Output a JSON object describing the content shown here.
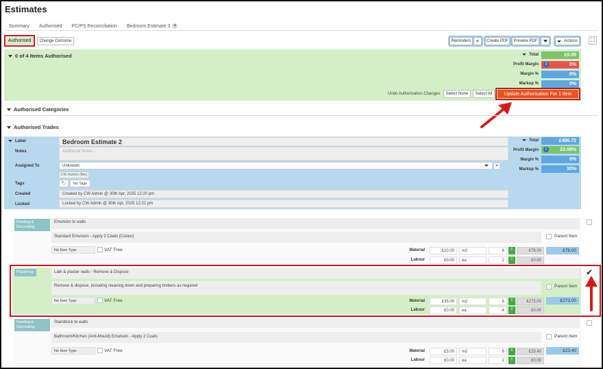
{
  "page": {
    "title": "Estimates"
  },
  "tabs": [
    {
      "label": "Summary"
    },
    {
      "label": "Authorised"
    },
    {
      "label": "PC/PS Reconciliation"
    },
    {
      "label": "Bedroom Estimate 3"
    }
  ],
  "toolbar": {
    "status": "Authorised",
    "change_outcome": "Change Outcome",
    "reminders": "Reminders",
    "plus": "+",
    "create_pdf": "Create PDF",
    "preview_pdf": "Preview PDF",
    "actions": "Actions"
  },
  "summary": {
    "heading": "0 of 4 Items Authorised",
    "total_label": "Total",
    "total_value": "£0.00",
    "profit_label": "Profit Margin",
    "profit_value": "0%",
    "margin_label": "Margin %",
    "margin_value": "0%",
    "markup_label": "Markup %",
    "markup_value": "0%",
    "undo": "Undo Authorisation Changes",
    "select_none": "Select None",
    "select_all": "Select All",
    "update": "Update Authorisation For 1 Item"
  },
  "sections": {
    "categories": "Authorised Categories",
    "trades": "Authorised Trades"
  },
  "estimate": {
    "label_key": "Label",
    "label_value": "Bedroom Estimate 2",
    "notes_key": "Notes",
    "notes_placeholder": "Additional Notes...",
    "assigned_key": "Assigned To",
    "assigned_value": "Unknown",
    "assigned_chip": "CW Admin (Me)",
    "tags_key": "Tags",
    "tags_value": "No Tags",
    "created_key": "Created",
    "created_value": "Created by CW Admin @ 30th Apr, 2025 12:20 pm",
    "locked_key": "Locked",
    "locked_value": "Locked by CW Admin @ 30th Apr, 2025 12:22 pm",
    "total_label": "Total",
    "total_value": "£486.72",
    "profit_label": "Profit Margin",
    "profit_value": "23.08%",
    "margin_label": "Margin %",
    "margin_value": "0%",
    "markup_label": "Markup %",
    "markup_value": "30%"
  },
  "items": [
    {
      "trade": "Painting & Decorating",
      "name": "Emulsion to walls",
      "desc": "Standard Emulsion - Apply 2 Coats (Colour)",
      "parent": "Parent Item",
      "item_type": "No Item Type",
      "vat": "VAT Free",
      "mat_label": "Material",
      "mat_price": "£10.00",
      "mat_unit": "m2",
      "mat_qty": "6",
      "mat_total": "£78.00",
      "lab_label": "Labour",
      "lab_price": "£0.00",
      "lab_unit": "ea",
      "lab_qty": "2",
      "lab_total": "£0.00",
      "total": "£78.00"
    },
    {
      "trade": "Plastering",
      "name": "Lath & plaster walls - Remove & Dispose",
      "desc": "Remove & dispose, including cleaning down and preparing timbers as required",
      "parent": "Parent Item",
      "item_type": "No Item Type",
      "vat": "VAT Free",
      "mat_label": "Material",
      "mat_price": "£35.00",
      "mat_unit": "m2",
      "mat_qty": "6",
      "mat_total": "£273.00",
      "lab_label": "Labour",
      "lab_price": "£0.00",
      "lab_unit": "ea",
      "lab_qty": "-4",
      "lab_total": "£0.00",
      "total": "£273.00"
    },
    {
      "trade": "Painting & Decorating",
      "name": "Stainblock to walls",
      "desc": "Bathroom/Kitchen (Anti-Mould) Emulsion - Apply 2 Coats",
      "parent": "Parent Item",
      "item_type": "No Item Type",
      "vat": "VAT Free",
      "mat_label": "Material",
      "mat_price": "£3.00",
      "mat_unit": "m2",
      "mat_qty": "6",
      "mat_total": "£23.40",
      "lab_label": "Labour",
      "lab_price": "£0.00",
      "lab_unit": "ea",
      "lab_qty": "2",
      "lab_total": "£0.00",
      "total": "£23.40"
    }
  ],
  "colors": {
    "green": "#d4efc7",
    "blue": "#b8d8ee",
    "red": "#c8161d",
    "orange": "#e8521e",
    "total_green": "#7dc36c",
    "profit_red": "#e8534f",
    "pct_blue": "#5fa7e0"
  },
  "icons": {
    "info": "info-icon",
    "tag": "tag-icon",
    "check": "check-icon",
    "expand": "expand-icon"
  }
}
